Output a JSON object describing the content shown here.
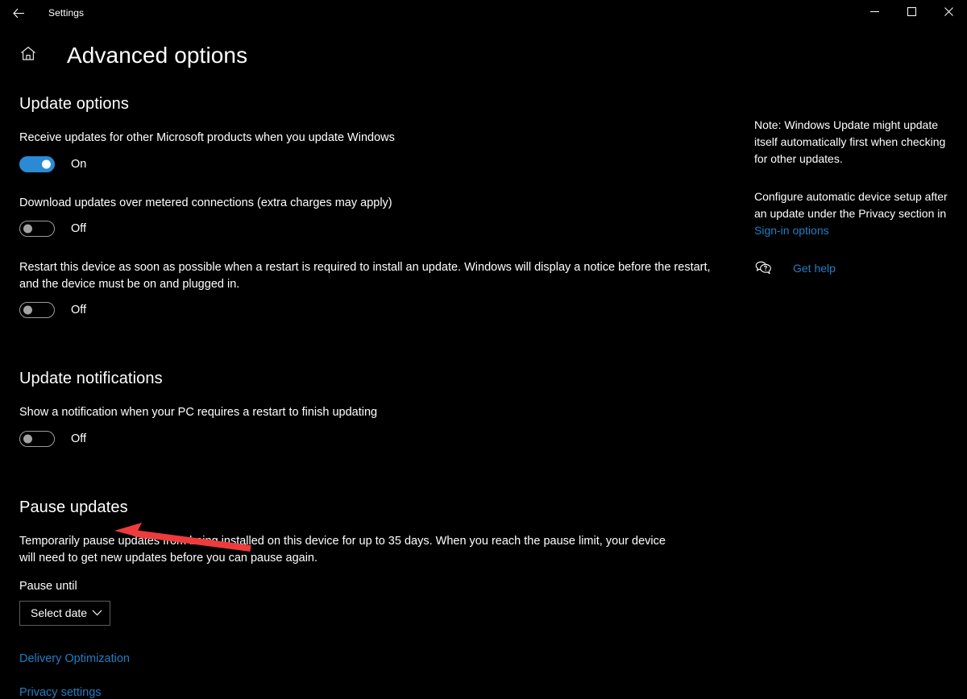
{
  "window": {
    "titlebar_title": "Settings",
    "back_icon": "back-arrow-icon",
    "minimize_icon": "minimize-icon",
    "maximize_icon": "maximize-icon",
    "close_icon": "close-icon"
  },
  "header": {
    "home_icon": "home-icon",
    "page_title": "Advanced options"
  },
  "colors": {
    "background": "#000000",
    "accent_toggle_on": "#2b8ad4",
    "link": "#1f7fc4",
    "toggle_off_border": "#9d9d9d",
    "combo_border": "#5c5c5c",
    "annotation_arrow": "#ee3b3b"
  },
  "update_options": {
    "title": "Update options",
    "settings": [
      {
        "description": "Receive updates for other Microsoft products when you update Windows",
        "state": "on",
        "state_label": "On"
      },
      {
        "description": "Download updates over metered connections (extra charges may apply)",
        "state": "off",
        "state_label": "Off"
      },
      {
        "description": "Restart this device as soon as possible when a restart is required to install an update. Windows will display a notice before the restart, and the device must be on and plugged in.",
        "state": "off",
        "state_label": "Off"
      }
    ]
  },
  "update_notifications": {
    "title": "Update notifications",
    "settings": [
      {
        "description": "Show a notification when your PC requires a restart to finish updating",
        "state": "off",
        "state_label": "Off"
      }
    ]
  },
  "pause_updates": {
    "title": "Pause updates",
    "description": "Temporarily pause updates from being installed on this device for up to 35 days. When you reach the pause limit, your device will need to get new updates before you can pause again.",
    "field_label": "Pause until",
    "combo_value": "Select date",
    "combo_chevron_icon": "chevron-down-icon"
  },
  "footer_links": [
    {
      "label": "Delivery Optimization"
    },
    {
      "label": "Privacy settings"
    }
  ],
  "right_panel": {
    "note_text": "Note: Windows Update might update itself automatically first when checking for other updates.",
    "configure_text_before": "Configure automatic device setup after an update under the Privacy section in ",
    "configure_link": "Sign-in options",
    "help_icon": "help-speech-bubble-icon",
    "help_label": "Get help"
  },
  "annotation": {
    "type": "arrow",
    "color": "#ee3b3b",
    "points_to": "Select date combo box"
  }
}
